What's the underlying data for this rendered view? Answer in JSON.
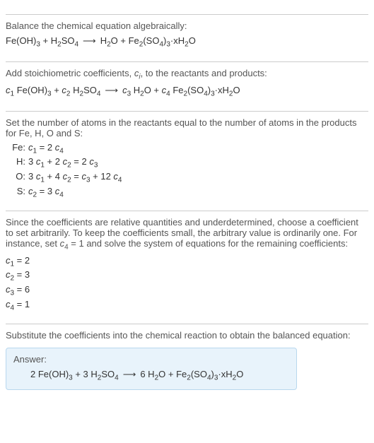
{
  "sec1": {
    "text": "Balance the chemical equation algebraically:",
    "lhs1": "Fe(OH)",
    "lhs1_sub": "3",
    "plus": " + ",
    "lhs2a": "H",
    "lhs2a_sub": "2",
    "lhs2b": "SO",
    "lhs2b_sub": "4",
    "arrow": "⟶",
    "rhs1a": "H",
    "rhs1a_sub": "2",
    "rhs1b": "O + Fe",
    "rhs1b_sub": "2",
    "rhs1c": "(SO",
    "rhs1c_sub": "4",
    "rhs1d": ")",
    "rhs1d_sub": "3",
    "rhs1e": "·xH",
    "rhs1e_sub": "2",
    "rhs1f": "O"
  },
  "sec2": {
    "text_a": "Add stoichiometric coefficients, ",
    "ci_c": "c",
    "ci_i": "i",
    "text_b": ", to the reactants and products:",
    "c1": "c",
    "c1s": "1",
    "sp": " ",
    "t1": "Fe(OH)",
    "t1s": "3",
    "plus": " + ",
    "c2": "c",
    "c2s": "2",
    "t2a": "H",
    "t2as": "2",
    "t2b": "SO",
    "t2bs": "4",
    "arrow": "⟶",
    "c3": "c",
    "c3s": "3",
    "t3a": "H",
    "t3as": "2",
    "t3b": "O + ",
    "c4": "c",
    "c4s": "4",
    "t4a": "Fe",
    "t4as": "2",
    "t4b": "(SO",
    "t4bs": "4",
    "t4c": ")",
    "t4cs": "3",
    "t4d": "·xH",
    "t4ds": "2",
    "t4e": "O"
  },
  "sec3": {
    "text": "Set the number of atoms in the reactants equal to the number of atoms in the products for Fe, H, O and S:",
    "rows": [
      {
        "label": "Fe:",
        "c1": "c",
        "c1s": "1",
        "eq": " = 2 ",
        "cr": "c",
        "crs": "4"
      },
      {
        "label": "H:",
        "pre": "3 ",
        "c1": "c",
        "c1s": "1",
        "mid": " + 2 ",
        "c2": "c",
        "c2s": "2",
        "eq": " = 2 ",
        "cr": "c",
        "crs": "3"
      },
      {
        "label": "O:",
        "pre": "3 ",
        "c1": "c",
        "c1s": "1",
        "mid": " + 4 ",
        "c2": "c",
        "c2s": "2",
        "eq": " = ",
        "cr1": "c",
        "cr1s": "3",
        "mid2": " + 12 ",
        "cr2": "c",
        "cr2s": "4"
      },
      {
        "label": "S:",
        "c1": "c",
        "c1s": "2",
        "eq": " = 3 ",
        "cr": "c",
        "crs": "4"
      }
    ]
  },
  "sec4": {
    "text_a": "Since the coefficients are relative quantities and underdetermined, choose a coefficient to set arbitrarily. To keep the coefficients small, the arbitrary value is ordinarily one. For instance, set ",
    "cv": "c",
    "cvs": "4",
    "text_b": " = 1 and solve the system of equations for the remaining coefficients:",
    "lines": [
      {
        "c": "c",
        "cs": "1",
        "eq": " = 2"
      },
      {
        "c": "c",
        "cs": "2",
        "eq": " = 3"
      },
      {
        "c": "c",
        "cs": "3",
        "eq": " = 6"
      },
      {
        "c": "c",
        "cs": "4",
        "eq": " = 1"
      }
    ]
  },
  "sec5": {
    "text": "Substitute the coefficients into the chemical reaction to obtain the balanced equation:",
    "answer_label": "Answer:",
    "eq": {
      "a": "2 Fe(OH)",
      "as": "3",
      "plus1": " + 3 H",
      "b1s": "2",
      "b2": "SO",
      "b2s": "4",
      "arrow": "⟶",
      "c1": "6 H",
      "c1s": "2",
      "c2": "O + Fe",
      "c2s": "2",
      "c3": "(SO",
      "c3s": "4",
      "c4": ")",
      "c4s": "3",
      "c5": "·xH",
      "c5s": "2",
      "c6": "O"
    }
  }
}
